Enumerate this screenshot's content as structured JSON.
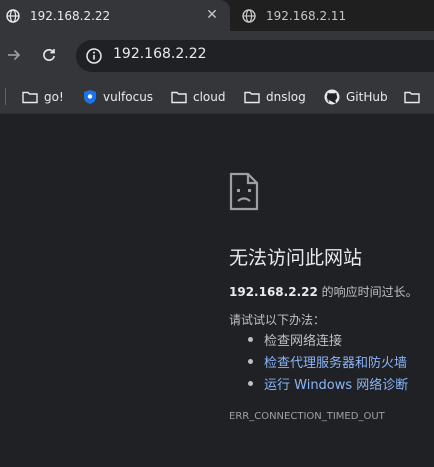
{
  "tabs": [
    {
      "title": "192.168.2.22",
      "active": true,
      "icon": "globe-icon"
    },
    {
      "title": "192.168.2.11",
      "active": false,
      "icon": "globe-icon"
    }
  ],
  "tab_close_symbol": "✕",
  "toolbar": {
    "url": "192.168.2.22",
    "forward_icon": "forward-arrow-icon",
    "reload_icon": "reload-icon",
    "site_info_icon": "info-icon"
  },
  "bookmarks": [
    {
      "label": "go!",
      "icon": "folder-icon"
    },
    {
      "label": "vulfocus",
      "icon": "vulfocus-shield-icon"
    },
    {
      "label": "cloud",
      "icon": "folder-icon"
    },
    {
      "label": "dnslog",
      "icon": "folder-icon"
    },
    {
      "label": "GitHub",
      "icon": "github-icon"
    },
    {
      "label": "",
      "icon": "folder-icon"
    }
  ],
  "error": {
    "heading": "无法访问此网站",
    "host": "192.168.2.22",
    "detail_suffix": " 的响应时间过长。",
    "try_label": "请试试以下办法：",
    "suggestions": [
      {
        "text": "检查网络连接",
        "link": false
      },
      {
        "text": "检查代理服务器和防火墙",
        "link": true
      },
      {
        "text": "运行 Windows 网络诊断",
        "link": true
      }
    ],
    "code": "ERR_CONNECTION_TIMED_OUT",
    "icon": "sad-page-icon"
  },
  "colors": {
    "background": "#202124",
    "toolbar": "#35363a",
    "link": "#8ab4f8",
    "text": "#e8eaed"
  }
}
